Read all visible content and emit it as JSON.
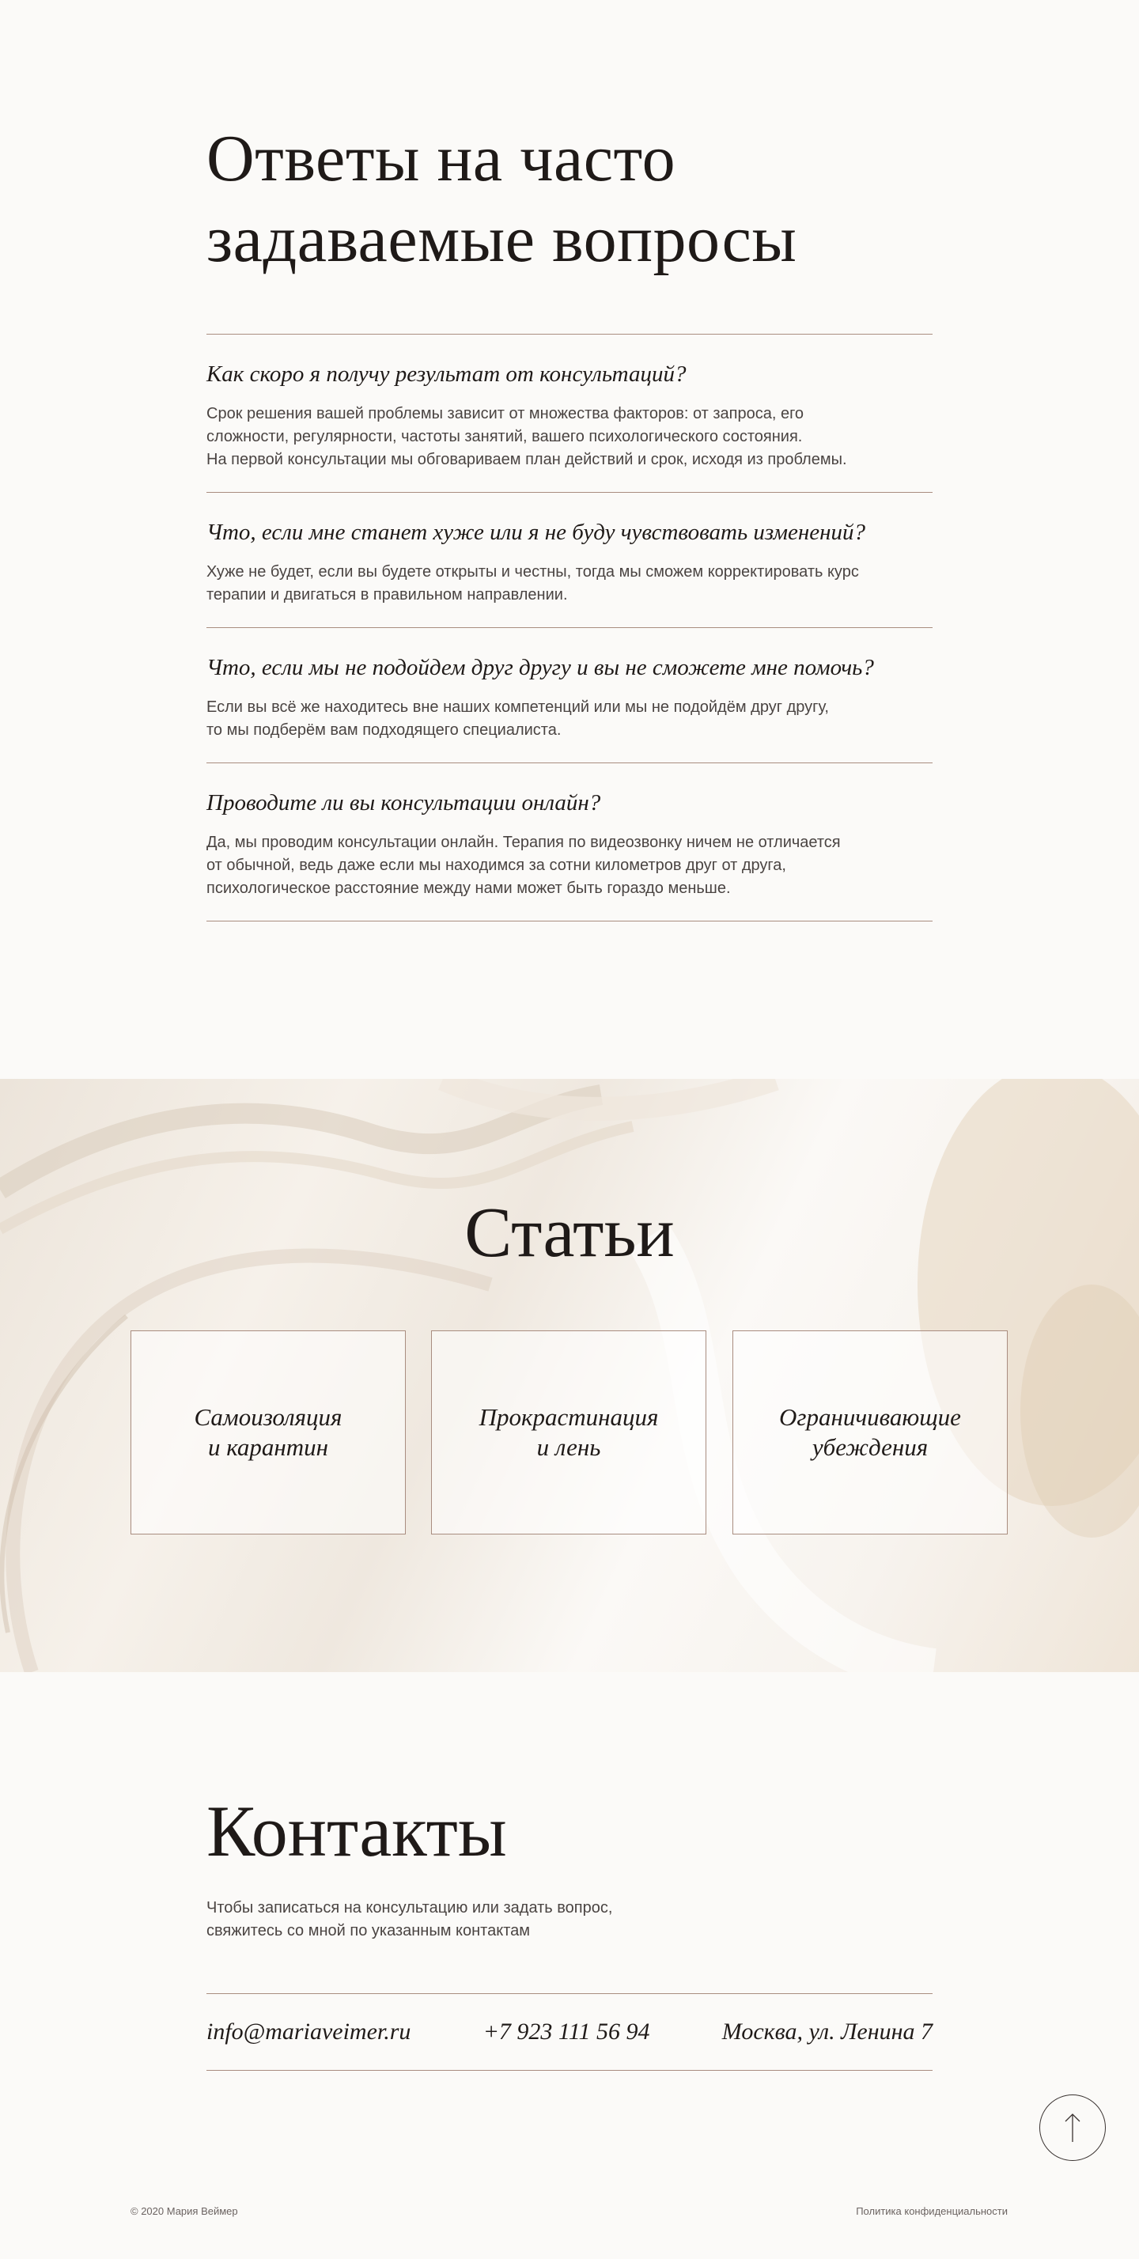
{
  "faq": {
    "title": "Ответы на часто задаваемые вопросы",
    "items": [
      {
        "question": "Как скоро я получу результат от консультаций?",
        "answer": "Срок решения вашей проблемы зависит от множества факторов: от запроса, его\nсложности, регулярности, частоты занятий, вашего психологического состояния.\nНа первой консультации мы обговариваем план действий и срок, исходя из проблемы."
      },
      {
        "question": "Что, если мне станет хуже или я не буду чувствовать изменений?",
        "answer": "Хуже не будет, если вы будете открыты и честны, тогда мы сможем корректировать курс\nтерапии и двигаться в правильном направлении."
      },
      {
        "question": "Что, если мы не подойдем друг другу и вы не сможете мне помочь?",
        "answer": "Если вы всё же находитесь вне наших компетенций или мы не подойдём друг другу,\nто мы подберём вам подходящего специалиста."
      },
      {
        "question": "Проводите ли вы консультации онлайн?",
        "answer": "Да, мы проводим консультации онлайн. Терапия по видеозвонку ничем не отличается\nот обычной, ведь даже если мы находимся за сотни километров друг от друга,\nпсихологическое расстояние между нами может быть гораздо меньше."
      }
    ]
  },
  "articles": {
    "title": "Статьи",
    "cards": [
      {
        "label": "Самоизоляция\nи карантин"
      },
      {
        "label": "Прокрастинация\nи лень"
      },
      {
        "label": "Ограничивающие\nубеждения"
      }
    ]
  },
  "contacts": {
    "title": "Контакты",
    "description": "Чтобы записаться на консультацию или задать вопрос,\nсвяжитесь со мной по указанным контактам",
    "email": "info@mariaveimer.ru",
    "phone": "+7 923 111 56 94",
    "address": "Москва, ул. Ленина 7"
  },
  "scroll_top": {
    "icon": "arrow-up-icon"
  },
  "footer": {
    "copyright": "© 2020 Мария Веймер",
    "policy": "Политика конфиденциальности"
  },
  "colors": {
    "background": "#fbfaf8",
    "accent_line": "#a98d80",
    "text": "#1f1a18"
  }
}
